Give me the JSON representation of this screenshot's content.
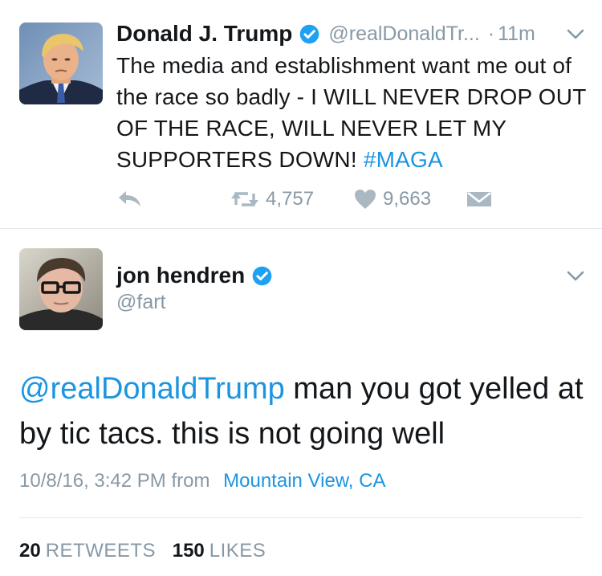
{
  "tweet1": {
    "author_name": "Donald J. Trump",
    "handle": "@realDonaldTr...",
    "separator": "·",
    "time": "11m",
    "text_main": "The media and establishment want me out of the race so badly -  I WILL NEVER DROP OUT OF THE RACE, WILL NEVER LET MY SUPPORTERS DOWN! ",
    "hashtag": "#MAGA",
    "retweet_count": "4,757",
    "like_count": "9,663",
    "icons": {
      "verified": "verified-badge-icon",
      "menu": "chevron-down-icon",
      "reply": "reply-icon",
      "retweet": "retweet-icon",
      "like": "heart-icon",
      "dm": "direct-message-icon"
    }
  },
  "tweet2": {
    "author_name": "jon hendren",
    "handle": "@fart",
    "mention": "@realDonaldTrump",
    "text_rest": " man you got yelled at by tic tacs. this is not going well",
    "timestamp": "10/8/16, 3:42 PM",
    "from_label": "from",
    "location": "Mountain View, CA",
    "retweets_count": "20",
    "retweets_label": "RETWEETS",
    "likes_count": "150",
    "likes_label": "LIKES"
  },
  "colors": {
    "link_blue": "#1b95e0",
    "verified_blue": "#1da1f2",
    "muted_gray": "#8899a6",
    "text_dark": "#14171a",
    "divider": "#e1e8ed"
  }
}
